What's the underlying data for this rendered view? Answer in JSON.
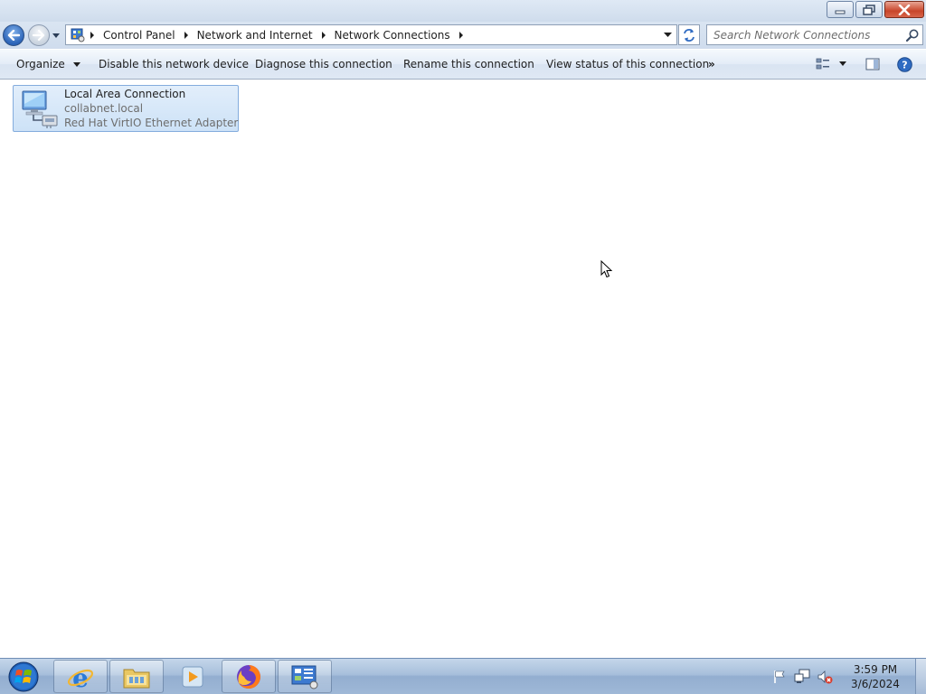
{
  "window": {
    "minimize_label": "Minimize",
    "restore_label": "Restore Down",
    "close_label": "Close"
  },
  "address_bar": {
    "breadcrumbs": [
      "Control Panel",
      "Network and Internet",
      "Network Connections"
    ]
  },
  "search": {
    "placeholder": "Search Network Connections"
  },
  "command_bar": {
    "organize": "Organize",
    "disable": "Disable this network device",
    "diagnose": "Diagnose this connection",
    "rename": "Rename this connection",
    "view_status": "View status of this connection",
    "more": "»"
  },
  "connections": [
    {
      "name": "Local Area Connection",
      "network": "collabnet.local",
      "device": "Red Hat VirtIO Ethernet Adapter",
      "icon": "network-adapter-icon"
    }
  ],
  "taskbar": {
    "apps": [
      "start-orb-icon",
      "internet-explorer-icon",
      "windows-explorer-icon",
      "media-player-icon",
      "firefox-icon",
      "control-panel-icon"
    ],
    "clock_time": "3:59 PM",
    "clock_date": "3/6/2024"
  },
  "colors": {
    "accent": "#3a6fc4",
    "selection": "#cde2f7",
    "close": "#c8452a"
  }
}
